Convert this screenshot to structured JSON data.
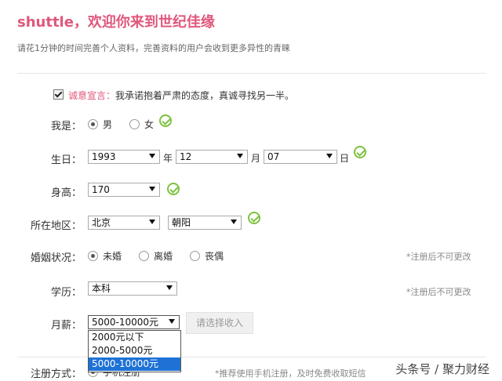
{
  "header": {
    "title": "shuttle，欢迎你来到世纪佳缘",
    "subtitle": "请花1分钟的时间完善个人资料，完善资料的用户会收到更多异性的青睐"
  },
  "pledge": {
    "label": "诚意宣言：",
    "text": "我承诺抱着严肃的态度，真诚寻找另一半。"
  },
  "gender": {
    "label": "我是：",
    "options": [
      "男",
      "女"
    ],
    "selected": "男"
  },
  "birthday": {
    "label": "生日：",
    "year": "1993",
    "year_unit": "年",
    "month": "12",
    "month_unit": "月",
    "day": "07",
    "day_unit": "日"
  },
  "height": {
    "label": "身高：",
    "value": "170"
  },
  "region": {
    "label": "所在地区：",
    "province": "北京",
    "district": "朝阳"
  },
  "marital": {
    "label": "婚姻状况：",
    "options": [
      "未婚",
      "离婚",
      "丧偶"
    ],
    "selected": "未婚",
    "hint": "*注册后不可更改"
  },
  "education": {
    "label": "学历：",
    "value": "本科",
    "hint": "*注册后不可更改"
  },
  "salary": {
    "label": "月薪：",
    "value": "5000-10000元",
    "button": "请选择收入",
    "options": [
      "2000元以下",
      "2000-5000元",
      "5000-10000元"
    ],
    "selected": "5000-10000元"
  },
  "register": {
    "label": "注册方式：",
    "option": "手机注册",
    "hint": "*推荐使用手机注册，及时免费收取短信"
  },
  "watermark": "头条号 / 聚力财经",
  "colors": {
    "accent": "#e0577b",
    "check": "#7cc23e",
    "selection": "#1e72d6"
  }
}
